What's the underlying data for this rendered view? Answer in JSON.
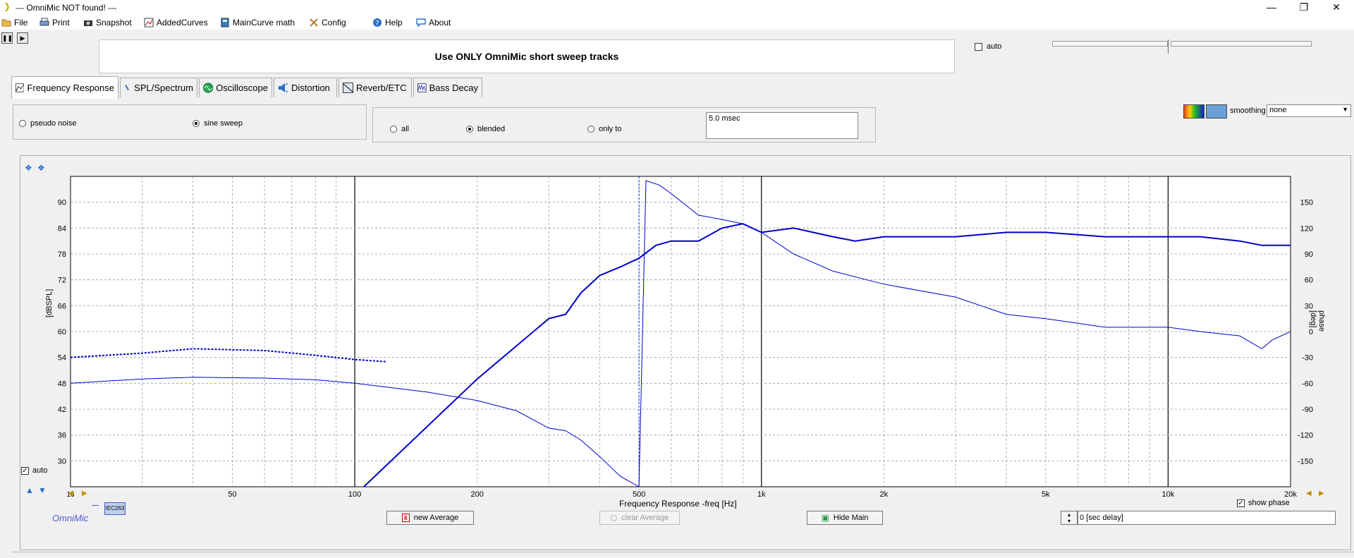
{
  "window": {
    "title": "--- OmniMic NOT found! ---"
  },
  "menu": [
    {
      "label": "File",
      "icon": "folder-icon"
    },
    {
      "label": "Print",
      "icon": "printer-icon"
    },
    {
      "label": "Snapshot",
      "icon": "camera-icon"
    },
    {
      "label": "AddedCurves",
      "icon": "curves-icon"
    },
    {
      "label": "MainCurve math",
      "icon": "calculator-icon"
    },
    {
      "label": "Config",
      "icon": "tools-icon"
    },
    {
      "label": "Help",
      "icon": "help-icon"
    },
    {
      "label": "About",
      "icon": "speech-bubble-icon"
    }
  ],
  "message": "Use ONLY OmniMic short sweep tracks",
  "auto_top": {
    "label": "auto",
    "checked": false
  },
  "tabs": [
    {
      "label": "Frequency Response",
      "active": true
    },
    {
      "label": "SPL/Spectrum",
      "active": false
    },
    {
      "label": "Oscilloscope",
      "active": false
    },
    {
      "label": "Distortion",
      "active": false
    },
    {
      "label": "Reverb/ETC",
      "active": false
    },
    {
      "label": "Bass Decay",
      "active": false
    }
  ],
  "signal_group": {
    "options": [
      {
        "label": "pseudo noise",
        "selected": false
      },
      {
        "label": "sine sweep",
        "selected": true
      }
    ]
  },
  "window_group": {
    "options": [
      {
        "label": "all",
        "selected": false
      },
      {
        "label": "blended",
        "selected": true
      },
      {
        "label": "only to",
        "selected": false
      }
    ],
    "msec_value": "5.0 msec"
  },
  "smoothing": {
    "label": "smoothing",
    "value": "none"
  },
  "chart_data": {
    "type": "line",
    "xlabel": "Frequency Response -freq [Hz]",
    "ylabel": "[dBSPL]",
    "ylabel_right": "phase [deg]",
    "x_scale": "log",
    "xlim": [
      20,
      20000
    ],
    "ylim": [
      24,
      96
    ],
    "ylim_right": [
      -180,
      180
    ],
    "x_ticks": [
      {
        "v": 50,
        "label": "50"
      },
      {
        "v": 100,
        "label": "100"
      },
      {
        "v": 200,
        "label": "200"
      },
      {
        "v": 500,
        "label": "500"
      },
      {
        "v": 1000,
        "label": "1k"
      },
      {
        "v": 2000,
        "label": "2k"
      },
      {
        "v": 5000,
        "label": "5k"
      },
      {
        "v": 10000,
        "label": "10k"
      },
      {
        "v": 20000,
        "label": "20k"
      }
    ],
    "first_tick_label": "16",
    "y_ticks": [
      30,
      36,
      42,
      48,
      54,
      60,
      66,
      72,
      78,
      84,
      90
    ],
    "y_ticks_right": [
      -150,
      -120,
      -90,
      -60,
      -30,
      0,
      30,
      60,
      90,
      120,
      150
    ],
    "marker_freq": 500,
    "grid": true,
    "series": [
      {
        "type": "magnitude",
        "x": [
          100,
          200,
          300,
          330,
          360,
          400,
          450,
          500,
          550,
          600,
          700,
          800,
          900,
          1000,
          1200,
          1500,
          1700,
          2000,
          3000,
          4000,
          5000,
          7000,
          10000,
          12000,
          15000,
          17000,
          20000
        ],
        "y": [
          22,
          49,
          63,
          64,
          69,
          73,
          75,
          77,
          80,
          81,
          81,
          84,
          85,
          83,
          84,
          82,
          81,
          82,
          82,
          83,
          83,
          82,
          82,
          82,
          81,
          80,
          80
        ]
      },
      {
        "type": "magnitude",
        "style": "dashed",
        "x": [
          20,
          30,
          40,
          60,
          80,
          100,
          120
        ],
        "y": [
          54,
          55,
          56,
          55.6,
          54.5,
          53.5,
          53
        ]
      },
      {
        "type": "phase",
        "x": [
          20,
          30,
          40,
          60,
          80,
          100,
          150,
          200,
          250,
          300,
          330,
          360,
          400,
          450,
          500,
          520,
          560,
          600,
          700,
          800,
          900,
          1000,
          1200,
          1500,
          2000,
          3000,
          4000,
          5000,
          7000,
          10000,
          12000,
          15000,
          17000,
          18000,
          20000
        ],
        "y": [
          -60,
          -55,
          -53,
          -54,
          -56,
          -60,
          -70,
          -80,
          -92,
          -112,
          -115,
          -126,
          -145,
          -168,
          -180,
          175,
          170,
          160,
          135,
          130,
          125,
          115,
          90,
          70,
          55,
          40,
          20,
          15,
          5,
          5,
          0,
          -5,
          -20,
          -10,
          0
        ]
      }
    ]
  },
  "auto_chart": {
    "label": "auto",
    "checked": true
  },
  "show_phase": {
    "label": "show phase",
    "checked": true
  },
  "brand": {
    "label": "OmniMic",
    "badge": "IEC263"
  },
  "buttons": {
    "new_average": "new Average",
    "clear_average": "clear Average",
    "hide_main": "Hide Main"
  },
  "delay": {
    "value": "0 [sec delay]"
  },
  "colors": {
    "curve": "#0000cc",
    "grid": "#888888",
    "accent": "#4b5bcc"
  }
}
